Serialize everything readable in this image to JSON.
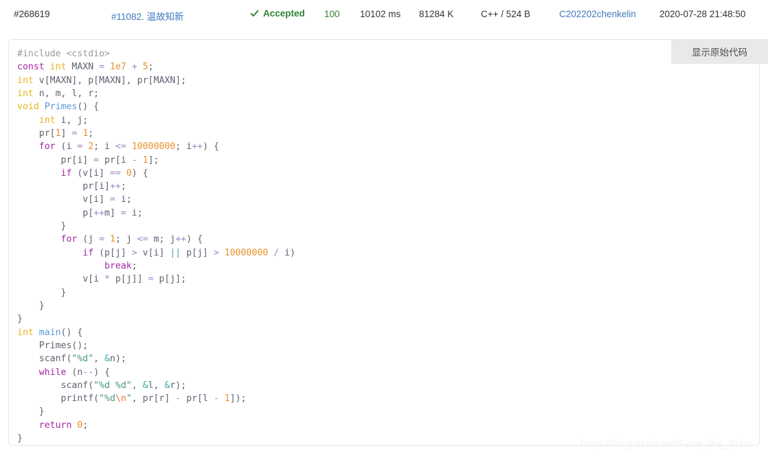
{
  "header": {
    "submission_id": "#268619",
    "problem": "#11082. 温故知新",
    "status": "Accepted",
    "status_icon": "check-icon",
    "score": "100",
    "time": "10102 ms",
    "memory": "81284 K",
    "language": "C++ / 524 B",
    "user": "C202202chenkelin",
    "datetime": "2020-07-28 21:48:50"
  },
  "panel": {
    "show_source_label": "显示原始代码"
  },
  "watermark": {
    "text": "https://blog.csdn.net/Face_the_Blast"
  },
  "colors": {
    "accent_link": "#4078c0",
    "status_green": "#2f8132",
    "panel_border": "#e4e4e4",
    "button_bg": "#e8e9eb",
    "code_plain": "#5c6370",
    "code_keyword": "#a626a4",
    "code_type": "#e6b422",
    "code_number": "#e8912d",
    "code_operator": "#a085c4",
    "code_logic": "#3fa7a7",
    "code_string": "#4a9a7b",
    "code_escape": "#e8743b",
    "code_function": "#5a9bd5",
    "code_preprocessor": "#9b9b9b"
  },
  "code": {
    "language": "cpp",
    "lines": [
      [
        {
          "t": "#include <cstdio>",
          "c": "tok-pre"
        }
      ],
      [
        {
          "t": "const",
          "c": "tok-kw"
        },
        {
          "t": " ",
          "c": "tok-plain"
        },
        {
          "t": "int",
          "c": "tok-type"
        },
        {
          "t": " MAXN ",
          "c": "tok-plain"
        },
        {
          "t": "=",
          "c": "tok-op"
        },
        {
          "t": " ",
          "c": "tok-plain"
        },
        {
          "t": "1e7",
          "c": "tok-num"
        },
        {
          "t": " ",
          "c": "tok-plain"
        },
        {
          "t": "+",
          "c": "tok-op"
        },
        {
          "t": " ",
          "c": "tok-plain"
        },
        {
          "t": "5",
          "c": "tok-num"
        },
        {
          "t": ";",
          "c": "tok-plain"
        }
      ],
      [
        {
          "t": "int",
          "c": "tok-type"
        },
        {
          "t": " v[MAXN], p[MAXN], pr[MAXN];",
          "c": "tok-plain"
        }
      ],
      [
        {
          "t": "int",
          "c": "tok-type"
        },
        {
          "t": " n, m, l, r;",
          "c": "tok-plain"
        }
      ],
      [
        {
          "t": "void",
          "c": "tok-type"
        },
        {
          "t": " ",
          "c": "tok-plain"
        },
        {
          "t": "Primes",
          "c": "tok-fn"
        },
        {
          "t": "() {",
          "c": "tok-plain"
        }
      ],
      [
        {
          "t": "    ",
          "c": "tok-plain"
        },
        {
          "t": "int",
          "c": "tok-type"
        },
        {
          "t": " i, j;",
          "c": "tok-plain"
        }
      ],
      [
        {
          "t": "    pr[",
          "c": "tok-plain"
        },
        {
          "t": "1",
          "c": "tok-num"
        },
        {
          "t": "] ",
          "c": "tok-plain"
        },
        {
          "t": "=",
          "c": "tok-op"
        },
        {
          "t": " ",
          "c": "tok-plain"
        },
        {
          "t": "1",
          "c": "tok-num"
        },
        {
          "t": ";",
          "c": "tok-plain"
        }
      ],
      [
        {
          "t": "    ",
          "c": "tok-plain"
        },
        {
          "t": "for",
          "c": "tok-kw"
        },
        {
          "t": " (i ",
          "c": "tok-plain"
        },
        {
          "t": "=",
          "c": "tok-op"
        },
        {
          "t": " ",
          "c": "tok-plain"
        },
        {
          "t": "2",
          "c": "tok-num"
        },
        {
          "t": "; i ",
          "c": "tok-plain"
        },
        {
          "t": "<=",
          "c": "tok-op"
        },
        {
          "t": " ",
          "c": "tok-plain"
        },
        {
          "t": "10000000",
          "c": "tok-num"
        },
        {
          "t": "; i",
          "c": "tok-plain"
        },
        {
          "t": "++",
          "c": "tok-op"
        },
        {
          "t": ") {",
          "c": "tok-plain"
        }
      ],
      [
        {
          "t": "        pr[i] ",
          "c": "tok-plain"
        },
        {
          "t": "=",
          "c": "tok-op"
        },
        {
          "t": " pr[i ",
          "c": "tok-plain"
        },
        {
          "t": "-",
          "c": "tok-op"
        },
        {
          "t": " ",
          "c": "tok-plain"
        },
        {
          "t": "1",
          "c": "tok-num"
        },
        {
          "t": "];",
          "c": "tok-plain"
        }
      ],
      [
        {
          "t": "        ",
          "c": "tok-plain"
        },
        {
          "t": "if",
          "c": "tok-kw"
        },
        {
          "t": " (v[i] ",
          "c": "tok-plain"
        },
        {
          "t": "==",
          "c": "tok-op"
        },
        {
          "t": " ",
          "c": "tok-plain"
        },
        {
          "t": "0",
          "c": "tok-num"
        },
        {
          "t": ") {",
          "c": "tok-plain"
        }
      ],
      [
        {
          "t": "            pr[i]",
          "c": "tok-plain"
        },
        {
          "t": "++",
          "c": "tok-op"
        },
        {
          "t": ";",
          "c": "tok-plain"
        }
      ],
      [
        {
          "t": "            v[i] ",
          "c": "tok-plain"
        },
        {
          "t": "=",
          "c": "tok-op"
        },
        {
          "t": " i;",
          "c": "tok-plain"
        }
      ],
      [
        {
          "t": "            p[",
          "c": "tok-plain"
        },
        {
          "t": "++",
          "c": "tok-op"
        },
        {
          "t": "m] ",
          "c": "tok-plain"
        },
        {
          "t": "=",
          "c": "tok-op"
        },
        {
          "t": " i;",
          "c": "tok-plain"
        }
      ],
      [
        {
          "t": "        }",
          "c": "tok-plain"
        }
      ],
      [
        {
          "t": "        ",
          "c": "tok-plain"
        },
        {
          "t": "for",
          "c": "tok-kw"
        },
        {
          "t": " (j ",
          "c": "tok-plain"
        },
        {
          "t": "=",
          "c": "tok-op"
        },
        {
          "t": " ",
          "c": "tok-plain"
        },
        {
          "t": "1",
          "c": "tok-num"
        },
        {
          "t": "; j ",
          "c": "tok-plain"
        },
        {
          "t": "<=",
          "c": "tok-op"
        },
        {
          "t": " m; j",
          "c": "tok-plain"
        },
        {
          "t": "++",
          "c": "tok-op"
        },
        {
          "t": ") {",
          "c": "tok-plain"
        }
      ],
      [
        {
          "t": "            ",
          "c": "tok-plain"
        },
        {
          "t": "if",
          "c": "tok-kw"
        },
        {
          "t": " (p[j] ",
          "c": "tok-plain"
        },
        {
          "t": ">",
          "c": "tok-op"
        },
        {
          "t": " v[i] ",
          "c": "tok-plain"
        },
        {
          "t": "||",
          "c": "tok-logic"
        },
        {
          "t": " p[j] ",
          "c": "tok-plain"
        },
        {
          "t": ">",
          "c": "tok-op"
        },
        {
          "t": " ",
          "c": "tok-plain"
        },
        {
          "t": "10000000",
          "c": "tok-num"
        },
        {
          "t": " ",
          "c": "tok-plain"
        },
        {
          "t": "/",
          "c": "tok-op"
        },
        {
          "t": " i)",
          "c": "tok-plain"
        }
      ],
      [
        {
          "t": "                ",
          "c": "tok-plain"
        },
        {
          "t": "break",
          "c": "tok-kw"
        },
        {
          "t": ";",
          "c": "tok-plain"
        }
      ],
      [
        {
          "t": "            v[i ",
          "c": "tok-plain"
        },
        {
          "t": "*",
          "c": "tok-op"
        },
        {
          "t": " p[j]] ",
          "c": "tok-plain"
        },
        {
          "t": "=",
          "c": "tok-op"
        },
        {
          "t": " p[j];",
          "c": "tok-plain"
        }
      ],
      [
        {
          "t": "        }",
          "c": "tok-plain"
        }
      ],
      [
        {
          "t": "    }",
          "c": "tok-plain"
        }
      ],
      [
        {
          "t": "}",
          "c": "tok-plain"
        }
      ],
      [
        {
          "t": "int",
          "c": "tok-type"
        },
        {
          "t": " ",
          "c": "tok-plain"
        },
        {
          "t": "main",
          "c": "tok-fn"
        },
        {
          "t": "() {",
          "c": "tok-plain"
        }
      ],
      [
        {
          "t": "    Primes();",
          "c": "tok-plain"
        }
      ],
      [
        {
          "t": "    scanf(",
          "c": "tok-plain"
        },
        {
          "t": "\"%d\"",
          "c": "tok-str"
        },
        {
          "t": ", ",
          "c": "tok-plain"
        },
        {
          "t": "&",
          "c": "tok-logic"
        },
        {
          "t": "n);",
          "c": "tok-plain"
        }
      ],
      [
        {
          "t": "    ",
          "c": "tok-plain"
        },
        {
          "t": "while",
          "c": "tok-kw"
        },
        {
          "t": " (n",
          "c": "tok-plain"
        },
        {
          "t": "--",
          "c": "tok-op"
        },
        {
          "t": ") {",
          "c": "tok-plain"
        }
      ],
      [
        {
          "t": "        scanf(",
          "c": "tok-plain"
        },
        {
          "t": "\"%d %d\"",
          "c": "tok-str"
        },
        {
          "t": ", ",
          "c": "tok-plain"
        },
        {
          "t": "&",
          "c": "tok-logic"
        },
        {
          "t": "l, ",
          "c": "tok-plain"
        },
        {
          "t": "&",
          "c": "tok-logic"
        },
        {
          "t": "r);",
          "c": "tok-plain"
        }
      ],
      [
        {
          "t": "        printf(",
          "c": "tok-plain"
        },
        {
          "t": "\"%d",
          "c": "tok-str"
        },
        {
          "t": "\\n",
          "c": "tok-esc"
        },
        {
          "t": "\"",
          "c": "tok-str"
        },
        {
          "t": ", pr[r] ",
          "c": "tok-plain"
        },
        {
          "t": "-",
          "c": "tok-op"
        },
        {
          "t": " pr[l ",
          "c": "tok-plain"
        },
        {
          "t": "-",
          "c": "tok-op"
        },
        {
          "t": " ",
          "c": "tok-plain"
        },
        {
          "t": "1",
          "c": "tok-num"
        },
        {
          "t": "]);",
          "c": "tok-plain"
        }
      ],
      [
        {
          "t": "    }",
          "c": "tok-plain"
        }
      ],
      [
        {
          "t": "    ",
          "c": "tok-plain"
        },
        {
          "t": "return",
          "c": "tok-kw"
        },
        {
          "t": " ",
          "c": "tok-plain"
        },
        {
          "t": "0",
          "c": "tok-num"
        },
        {
          "t": ";",
          "c": "tok-plain"
        }
      ],
      [
        {
          "t": "}",
          "c": "tok-plain"
        }
      ]
    ]
  }
}
